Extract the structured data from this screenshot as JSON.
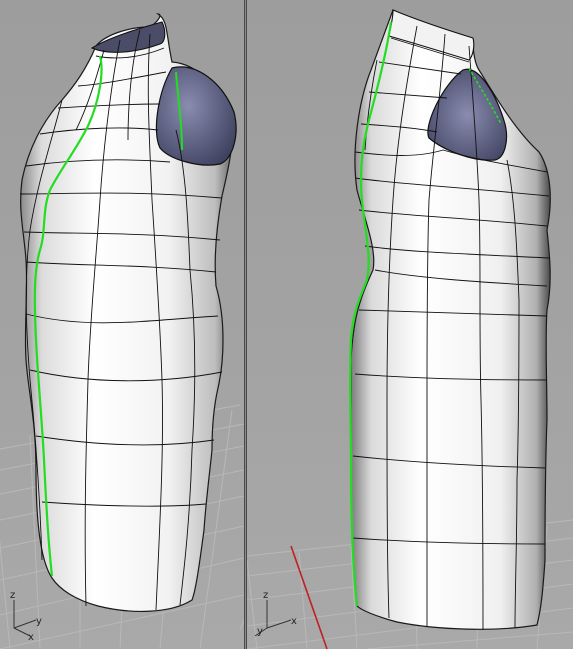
{
  "viewports": [
    {
      "id": "left",
      "axis_labels": {
        "z": "z",
        "y": "y",
        "x": "x"
      }
    },
    {
      "id": "right",
      "axis_labels": {
        "z": "z",
        "y": "y",
        "x": "x"
      }
    }
  ],
  "colors": {
    "viewport_bg": "#a3a3a3",
    "grid": "#b6b6b6",
    "x_axis": "#c02020",
    "seam": "#22dd22",
    "surface": "#f4f4f4",
    "armhole": "#6c6e8e"
  }
}
